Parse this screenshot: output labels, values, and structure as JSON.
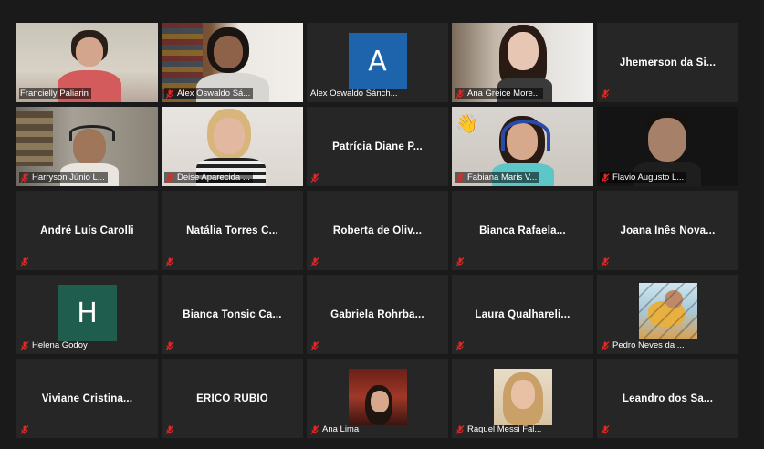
{
  "colors": {
    "background": "#1a1a1a",
    "tile": "#262626",
    "active_border": "#d6e84a",
    "muted": "#e02828",
    "avatar_blue": "#1e64ad",
    "avatar_green": "#1f5d4e"
  },
  "participants": [
    {
      "name": "Francielly Paliarin",
      "muted": false,
      "type": "video"
    },
    {
      "name": "Alex Oswaldo Sá...",
      "muted": true,
      "type": "video"
    },
    {
      "name": "Alex Oswaldo Sánch...",
      "muted": false,
      "type": "avatar",
      "initial": "A"
    },
    {
      "name": "Ana Greice More...",
      "muted": true,
      "type": "video"
    },
    {
      "name": "Jhemerson da Si...",
      "muted": true,
      "type": "name"
    },
    {
      "name": "Harryson Júnio L...",
      "muted": true,
      "type": "video"
    },
    {
      "name": "Deise Aparecida ...",
      "muted": true,
      "type": "video"
    },
    {
      "name": "Patrícia Diane P...",
      "muted": true,
      "type": "name"
    },
    {
      "name": "Fabiana Maris V...",
      "muted": true,
      "type": "video",
      "reaction": "👋"
    },
    {
      "name": "Flavio Augusto L...",
      "muted": true,
      "type": "video"
    },
    {
      "name": "André Luís Carolli",
      "muted": true,
      "type": "name"
    },
    {
      "name": "Natália Torres C...",
      "muted": true,
      "type": "name"
    },
    {
      "name": "Roberta de Oliv...",
      "muted": true,
      "type": "name"
    },
    {
      "name": "Bianca Rafaela...",
      "muted": true,
      "type": "name"
    },
    {
      "name": "Joana Inês Nova...",
      "muted": true,
      "type": "name"
    },
    {
      "name": "Helena Godoy",
      "muted": true,
      "type": "avatar",
      "initial": "H"
    },
    {
      "name": "Bianca Tonsic Ca...",
      "muted": true,
      "type": "name"
    },
    {
      "name": "Gabriela Rohrba...",
      "muted": true,
      "type": "name"
    },
    {
      "name": "Laura Qualhareli...",
      "muted": true,
      "type": "name"
    },
    {
      "name": "Pedro Neves da ...",
      "muted": true,
      "type": "photo"
    },
    {
      "name": "Viviane Cristina...",
      "muted": true,
      "type": "name"
    },
    {
      "name": "ERICO RUBIO",
      "muted": true,
      "type": "name"
    },
    {
      "name": "Leandro dos Sa...",
      "muted": true,
      "type": "name"
    },
    {
      "name": "Ana Lima",
      "muted": true,
      "type": "photo"
    },
    {
      "name": "Raquel Messi Fal...",
      "muted": true,
      "type": "photo"
    }
  ]
}
